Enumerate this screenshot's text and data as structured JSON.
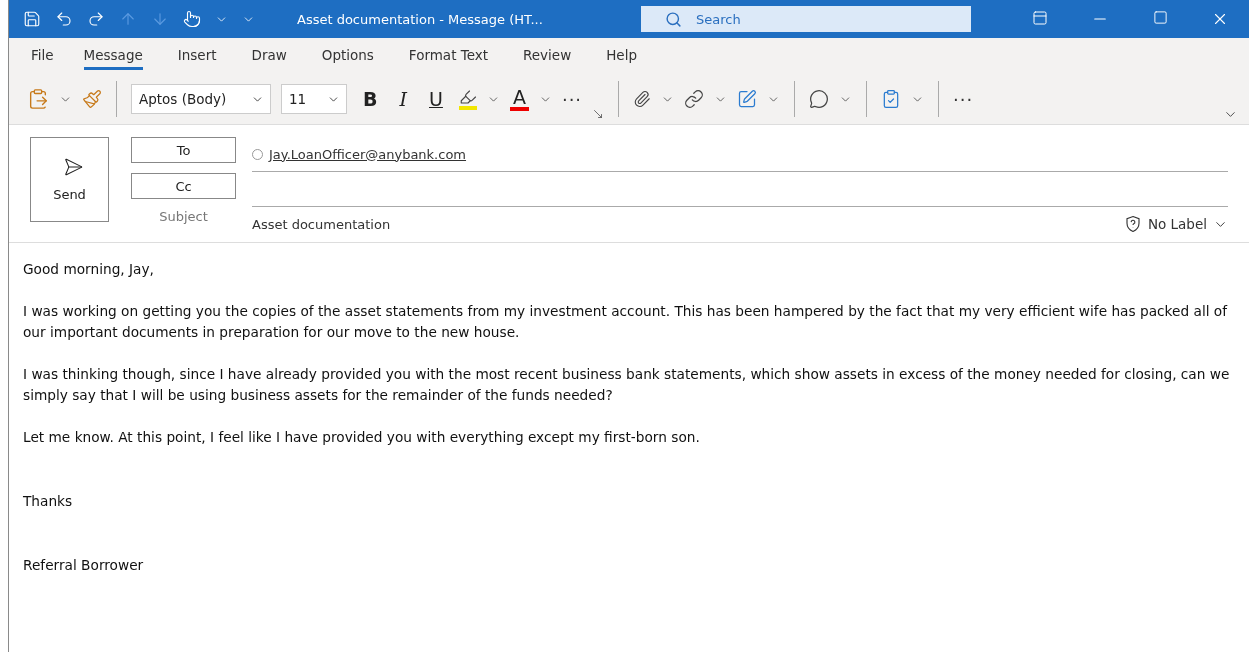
{
  "window": {
    "title": "Asset documentation  -  Message (HT..."
  },
  "search": {
    "placeholder": "Search"
  },
  "menu_tabs": [
    {
      "label": "File",
      "selected": false
    },
    {
      "label": "Message",
      "selected": true
    },
    {
      "label": "Insert",
      "selected": false
    },
    {
      "label": "Draw",
      "selected": false
    },
    {
      "label": "Options",
      "selected": false
    },
    {
      "label": "Format Text",
      "selected": false
    },
    {
      "label": "Review",
      "selected": false
    },
    {
      "label": "Help",
      "selected": false
    }
  ],
  "ribbon": {
    "font": "Aptos (Body)",
    "size": "11",
    "bold": "B",
    "italic": "I",
    "underline": "U",
    "font_color": "A",
    "more": "···",
    "more_end": "···"
  },
  "compose": {
    "send": "Send",
    "to_button": "To",
    "cc_button": "Cc",
    "subject_label": "Subject",
    "recipients": [
      "Jay.LoanOfficer@anybank.com"
    ],
    "subject": "Asset documentation",
    "sensitivity": "No Label"
  },
  "body": [
    {
      "kind": "paragraph",
      "text": "Good morning, Jay,"
    },
    {
      "kind": "paragraph",
      "text": "I was working on getting you the copies of the asset statements from my investment account.  This has been hampered by the fact that my very efficient wife has packed all of our important documents in preparation for our move to the new house."
    },
    {
      "kind": "paragraph",
      "text": "I was thinking though, since I have already provided you with the most recent business bank statements, which show assets in excess of the money needed for closing, can we simply say that I will be using business assets for the remainder of the funds needed?"
    },
    {
      "kind": "paragraph",
      "text": "Let me know.  At this point, I feel like I have provided you with everything except my first-born son."
    },
    {
      "kind": "closing",
      "text": "Thanks"
    },
    {
      "kind": "closing",
      "text": "Referral Borrower"
    }
  ]
}
